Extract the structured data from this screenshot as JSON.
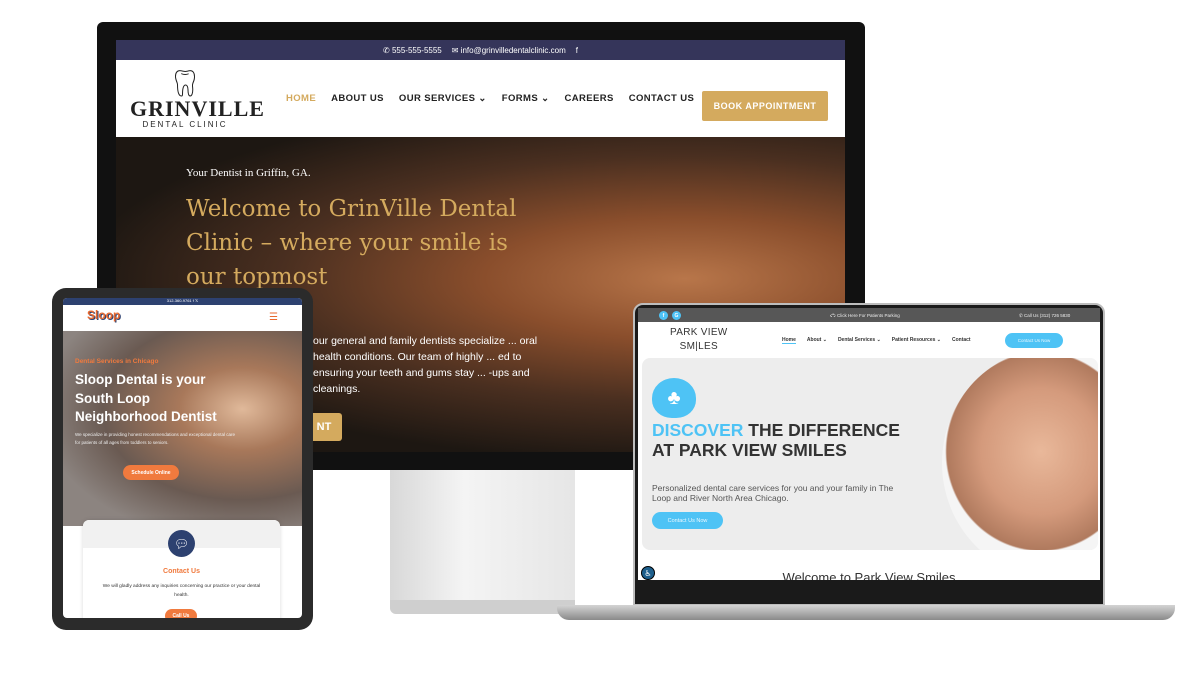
{
  "desktop": {
    "topbar": {
      "phone": "555-555-5555",
      "email": "info@grinvilledentalclinic.com",
      "social_icon": "facebook-icon"
    },
    "logo": {
      "name": "GRINVILLE",
      "tagline": "DENTAL CLINIC"
    },
    "nav": [
      {
        "label": "HOME",
        "active": true
      },
      {
        "label": "ABOUT US"
      },
      {
        "label": "OUR SERVICES ⌄"
      },
      {
        "label": "FORMS ⌄"
      },
      {
        "label": "CAREERS"
      },
      {
        "label": "CONTACT US"
      }
    ],
    "book_button": "BOOK APPOINTMENT",
    "hero": {
      "subtitle": "Your Dentist in Griffin, GA.",
      "title": "Welcome to GrinVille Dental Clinic – where your smile is our topmost",
      "paragraph": "our general and family dentists specialize ... oral health conditions. Our team of highly ... ed to ensuring your teeth and gums stay ... -ups and cleanings.",
      "button_fragment": "NT"
    },
    "accent_color": "#d4aa5e",
    "topbar_color": "#35355a"
  },
  "tablet": {
    "topbar": {
      "phone": "312-360-9761"
    },
    "logo": "Sloop",
    "hero": {
      "kicker": "Dental Services in Chicago",
      "title": "Sloop Dental is your South Loop Neighborhood Dentist",
      "paragraph": "We specialize in providing honest recommendations and exceptional dental care for patients of all ages from toddlers to seniors.",
      "button": "Schedule Online"
    },
    "contact_card": {
      "title": "Contact Us",
      "text": "We will gladly address any inquiries concerning our practice or your dental health.",
      "button": "Call Us"
    },
    "accent_color": "#f07a3e"
  },
  "laptop": {
    "topbar": {
      "parking": "Click Here For Patients Parking",
      "call": "Call Us (312) 726 5830"
    },
    "logo": {
      "line1": "PARK VIEW",
      "line2": "SM|LES"
    },
    "nav": [
      {
        "label": "Home",
        "active": true
      },
      {
        "label": "About ⌄"
      },
      {
        "label": "Dental Services ⌄"
      },
      {
        "label": "Patient Resources ⌄"
      },
      {
        "label": "Contact"
      }
    ],
    "nav_button": "Contact Us Now",
    "hero": {
      "title_highlight": "DISCOVER",
      "title_rest": " THE DIFFERENCE AT PARK VIEW SMILES",
      "paragraph": "Personalized dental care services for you and your family in The Loop and River North Area Chicago.",
      "button": "Contact Us Now"
    },
    "welcome": "Welcome to Park View Smiles",
    "accent_color": "#4ec3f5"
  }
}
